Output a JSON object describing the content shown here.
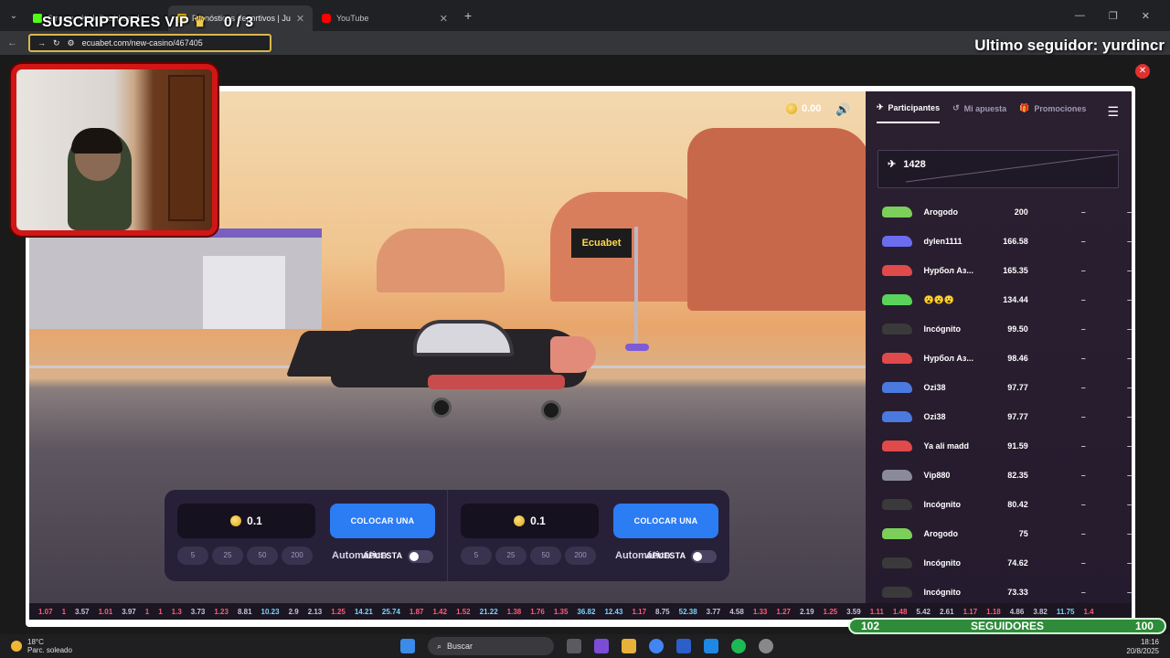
{
  "browser": {
    "tabs": [
      {
        "title": "Stream - Kick Dashboard",
        "active": false
      },
      {
        "title": "Pronósticos deportivos | Ju",
        "active": true
      },
      {
        "title": "YouTube",
        "active": false
      }
    ],
    "url": "ecuabet.com/new-casino/467405"
  },
  "overlay": {
    "vip_label": "SUSCRIPTORES VIP",
    "vip_count": "0 / 3",
    "last_follower": "Ultimo seguidor: yurdincr"
  },
  "game": {
    "balance": "0.00",
    "flag_text": "Ecuabet",
    "bets": [
      {
        "amount": "0.1",
        "button": "COLOCAR UNA APUESTA",
        "chips": [
          "5",
          "25",
          "50",
          "200"
        ],
        "auto_label": "Automático"
      },
      {
        "amount": "0.1",
        "button": "COLOCAR UNA APUESTA",
        "chips": [
          "5",
          "25",
          "50",
          "200"
        ],
        "auto_label": "Automático"
      }
    ]
  },
  "sidebar": {
    "tabs": [
      "Participantes",
      "Mi apuesta",
      "Promociones"
    ],
    "participants_count": "1428",
    "rows": [
      {
        "name": "Arogodo",
        "bet": "200",
        "c1": "–",
        "c2": "–",
        "color": "#7ccf5a"
      },
      {
        "name": "dylen1111",
        "bet": "166.58",
        "c1": "–",
        "c2": "–",
        "color": "#6c6cf0"
      },
      {
        "name": "Нурбол Аз...",
        "bet": "165.35",
        "c1": "–",
        "c2": "–",
        "color": "#e04a4a"
      },
      {
        "name": "😮😮😮",
        "bet": "134.44",
        "c1": "–",
        "c2": "–",
        "color": "#5ad35a"
      },
      {
        "name": "Incógnito",
        "bet": "99.50",
        "c1": "–",
        "c2": "–",
        "color": "#3a3a3a"
      },
      {
        "name": "Нурбол Аз...",
        "bet": "98.46",
        "c1": "–",
        "c2": "–",
        "color": "#e04a4a"
      },
      {
        "name": "Ozi38",
        "bet": "97.77",
        "c1": "–",
        "c2": "–",
        "color": "#4a7ae0"
      },
      {
        "name": "Ozi38",
        "bet": "97.77",
        "c1": "–",
        "c2": "–",
        "color": "#4a7ae0"
      },
      {
        "name": "Ya ali madd",
        "bet": "91.59",
        "c1": "–",
        "c2": "–",
        "color": "#e04a4a"
      },
      {
        "name": "Vip880",
        "bet": "82.35",
        "c1": "–",
        "c2": "–",
        "color": "#8a8a9a"
      },
      {
        "name": "Incógnito",
        "bet": "80.42",
        "c1": "–",
        "c2": "–",
        "color": "#3a3a3a"
      },
      {
        "name": "Arogodo",
        "bet": "75",
        "c1": "–",
        "c2": "–",
        "color": "#7ccf5a"
      },
      {
        "name": "Incógnito",
        "bet": "74.62",
        "c1": "–",
        "c2": "–",
        "color": "#3a3a3a"
      },
      {
        "name": "Incógnito",
        "bet": "73.33",
        "c1": "–",
        "c2": "–",
        "color": "#3a3a3a"
      }
    ]
  },
  "multipliers": [
    "1.07",
    "1",
    "3.57",
    "1.01",
    "3.97",
    "1",
    "1",
    "1.3",
    "3.73",
    "1.23",
    "8.81",
    "10.23",
    "2.9",
    "2.13",
    "1.25",
    "14.21",
    "25.74",
    "1.87",
    "1.42",
    "1.52",
    "21.22",
    "1.38",
    "1.76",
    "1.35",
    "36.82",
    "12.43",
    "1.17",
    "8.75",
    "52.38",
    "3.77",
    "4.58",
    "1.33",
    "1.27",
    "2.19",
    "1.25",
    "3.59",
    "1.11",
    "1.48",
    "5.42",
    "2.61",
    "1.17",
    "1.18",
    "4.86",
    "3.82",
    "11.75",
    "1.4"
  ],
  "followers": {
    "current": "102",
    "label": "SEGUIDORES",
    "goal": "100"
  },
  "taskbar": {
    "weather_temp": "18°C",
    "weather_desc": "Parc. soleado",
    "search_label": "Buscar",
    "time": "18:16",
    "date": "20/8/2025"
  }
}
